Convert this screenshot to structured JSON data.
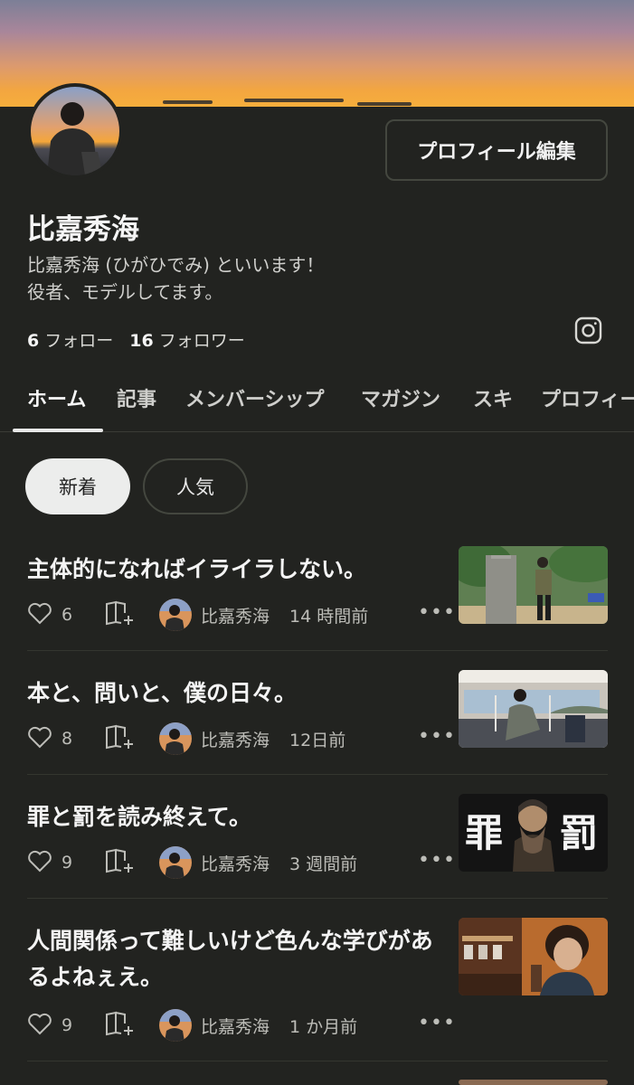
{
  "profile": {
    "edit_button": "プロフィール編集",
    "name": "比嘉秀海",
    "bio_line1": "比嘉秀海 (ひがひでみ) といいます！",
    "bio_line2": "役者、モデルしてます。",
    "follow_count": "6",
    "follow_label": "フォロー",
    "follower_count": "16",
    "follower_label": "フォロワー",
    "social_icon": "instagram-icon"
  },
  "tabs": [
    "ホーム",
    "記事",
    "メンバーシップ",
    "マガジン",
    "スキ",
    "プロフィー"
  ],
  "chips": {
    "new": "新着",
    "popular": "人気"
  },
  "articles": [
    {
      "title": "主体的になればイライラしない。",
      "likes": "6",
      "author": "比嘉秀海",
      "time": "14 時間前"
    },
    {
      "title": "本と、問いと、僕の日々。",
      "likes": "8",
      "author": "比嘉秀海",
      "time": "12日前"
    },
    {
      "title": "罪と罰を読み終えて。",
      "likes": "9",
      "author": "比嘉秀海",
      "time": "3 週間前"
    },
    {
      "title": "人間関係って難しいけど色んな学びがあるよねぇえ。",
      "likes": "9",
      "author": "比嘉秀海",
      "time": "1 か月前"
    }
  ],
  "thumb3": {
    "left_char": "罪",
    "right_char": "罰"
  },
  "colors": {
    "background": "#222320",
    "text": "#f2f2f2",
    "muted": "#bdbdb8",
    "border": "#44473f"
  }
}
